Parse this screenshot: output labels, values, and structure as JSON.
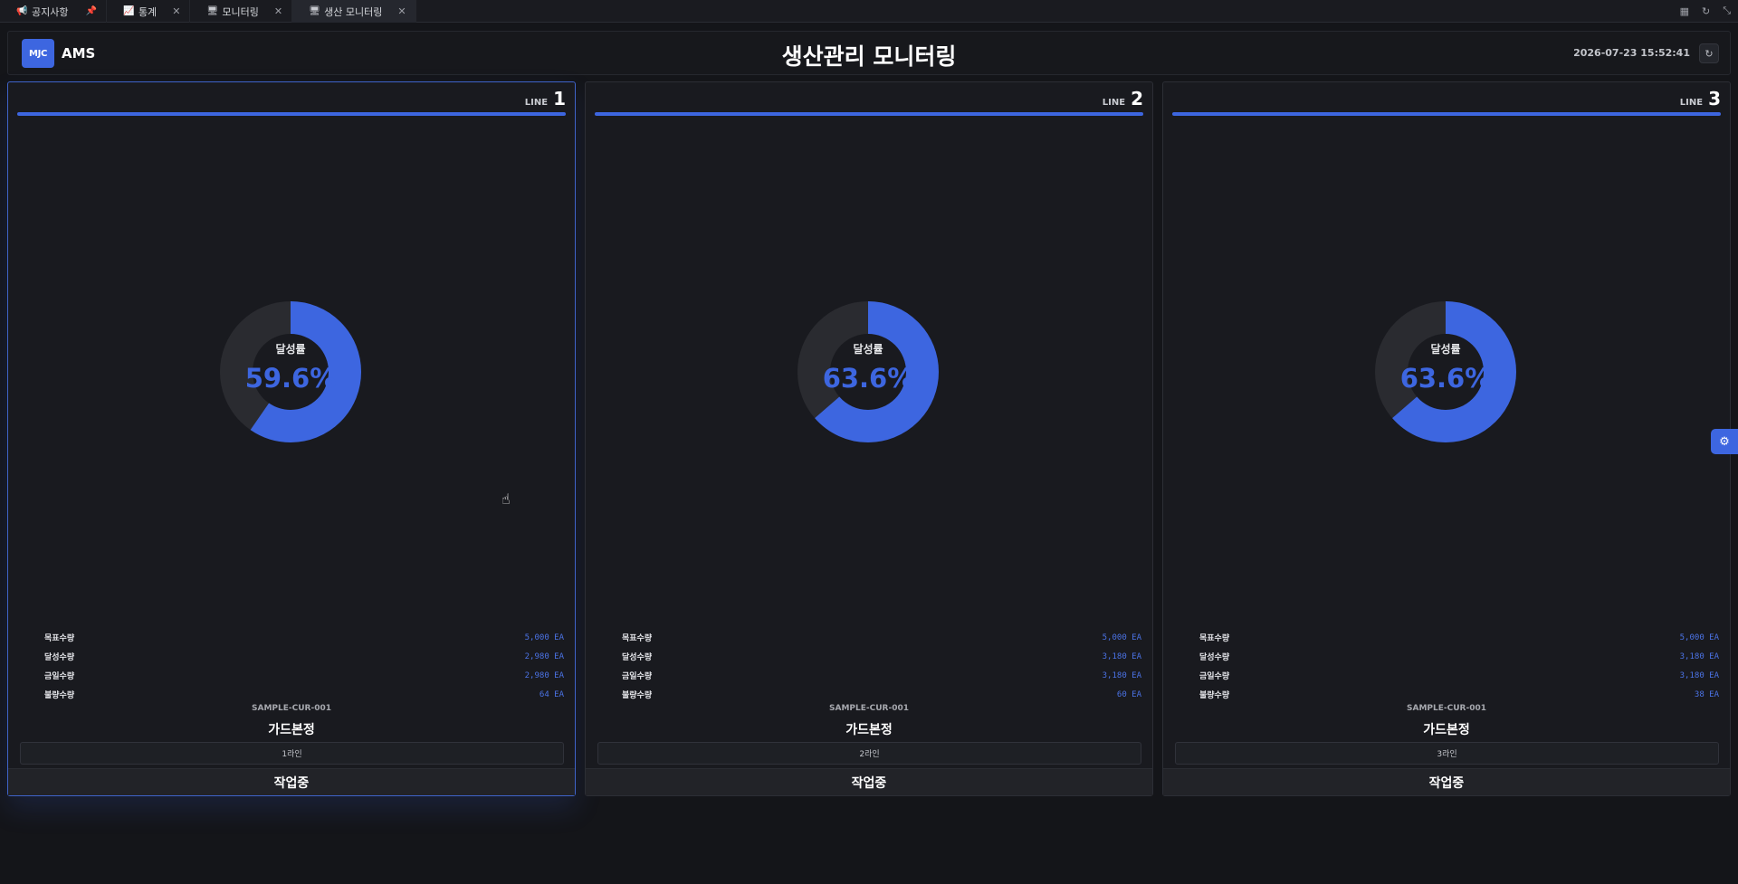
{
  "tabs": [
    {
      "icon": "megaphone-icon",
      "glyph": "📢",
      "label": "공지사항",
      "pinned": true
    },
    {
      "icon": "chart-icon",
      "glyph": "📈",
      "label": "통계",
      "closable": true
    },
    {
      "icon": "monitor-icon",
      "glyph": "🖥",
      "label": "모니터링",
      "closable": true
    },
    {
      "icon": "monitor-icon",
      "glyph": "🖥",
      "label": "생산 모니터링",
      "closable": true,
      "active": true
    }
  ],
  "header": {
    "logo_badge": "MJC",
    "logo_text": "AMS",
    "title": "생산관리 모니터링",
    "datetime": "2026-07-23 15:52:41"
  },
  "colors": {
    "accent": "#3d66e0",
    "track": "#2a2b30"
  },
  "lines": [
    {
      "line_word": "LINE",
      "line_no": "1",
      "rate_label": "달성률",
      "rate_text": "59.6%",
      "rate": 59.6,
      "stats": [
        {
          "name": "목표수량",
          "value": "5,000 EA"
        },
        {
          "name": "달성수량",
          "value": "2,980 EA"
        },
        {
          "name": "금일수량",
          "value": "2,980 EA"
        },
        {
          "name": "불량수량",
          "value": "64 EA"
        }
      ],
      "product_code": "SAMPLE-CUR-001",
      "product_name": "가드본정",
      "line_name": "1라인",
      "status": "작업중"
    },
    {
      "line_word": "LINE",
      "line_no": "2",
      "rate_label": "달성률",
      "rate_text": "63.6%",
      "rate": 63.6,
      "stats": [
        {
          "name": "목표수량",
          "value": "5,000 EA"
        },
        {
          "name": "달성수량",
          "value": "3,180 EA"
        },
        {
          "name": "금일수량",
          "value": "3,180 EA"
        },
        {
          "name": "불량수량",
          "value": "60 EA"
        }
      ],
      "product_code": "SAMPLE-CUR-001",
      "product_name": "가드본정",
      "line_name": "2라인",
      "status": "작업중"
    },
    {
      "line_word": "LINE",
      "line_no": "3",
      "rate_label": "달성률",
      "rate_text": "63.6%",
      "rate": 63.6,
      "stats": [
        {
          "name": "목표수량",
          "value": "5,000 EA"
        },
        {
          "name": "달성수량",
          "value": "3,180 EA"
        },
        {
          "name": "금일수량",
          "value": "3,180 EA"
        },
        {
          "name": "불량수량",
          "value": "38 EA"
        }
      ],
      "product_code": "SAMPLE-CUR-001",
      "product_name": "가드본정",
      "line_name": "3라인",
      "status": "작업중"
    }
  ]
}
